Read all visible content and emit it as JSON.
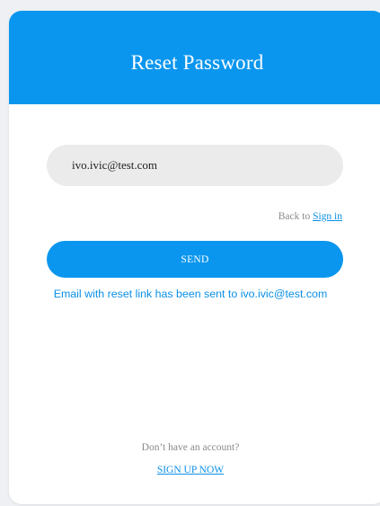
{
  "header": {
    "title": "Reset Password"
  },
  "form": {
    "email_value": "ivo.ivic@test.com",
    "back_prefix": "Back to ",
    "sign_in_label": "Sign in",
    "send_label": "SEND",
    "status_message": "Email with reset link has been sent to ivo.ivic@test.com"
  },
  "footer": {
    "prompt": "Don’t have an account?",
    "signup_label": "SIGN UP NOW"
  },
  "colors": {
    "accent": "#0a96ee",
    "input_bg": "#ebebeb",
    "muted_text": "#8a8a8a"
  }
}
